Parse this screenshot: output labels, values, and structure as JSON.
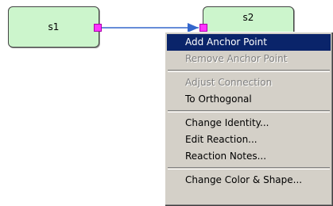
{
  "canvas": {
    "nodes": [
      {
        "id": "s1",
        "label": "s1"
      },
      {
        "id": "s2",
        "label": "s2"
      }
    ],
    "colors": {
      "node_fill": "#ccf5cc",
      "edge": "#3366cc",
      "handle": "#ff33ff",
      "menu_highlight": "#0a246a"
    }
  },
  "context_menu": {
    "items": [
      {
        "label": "Add Anchor Point",
        "state": "highlighted"
      },
      {
        "label": "Remove Anchor Point",
        "state": "disabled"
      },
      {
        "label": "Adjust Connection",
        "state": "disabled"
      },
      {
        "label": "To Orthogonal",
        "state": "enabled"
      },
      {
        "label": "Change Identity...",
        "state": "enabled"
      },
      {
        "label": "Edit Reaction...",
        "state": "enabled"
      },
      {
        "label": "Reaction Notes...",
        "state": "enabled"
      },
      {
        "label": "Change Color & Shape...",
        "state": "enabled"
      }
    ]
  }
}
